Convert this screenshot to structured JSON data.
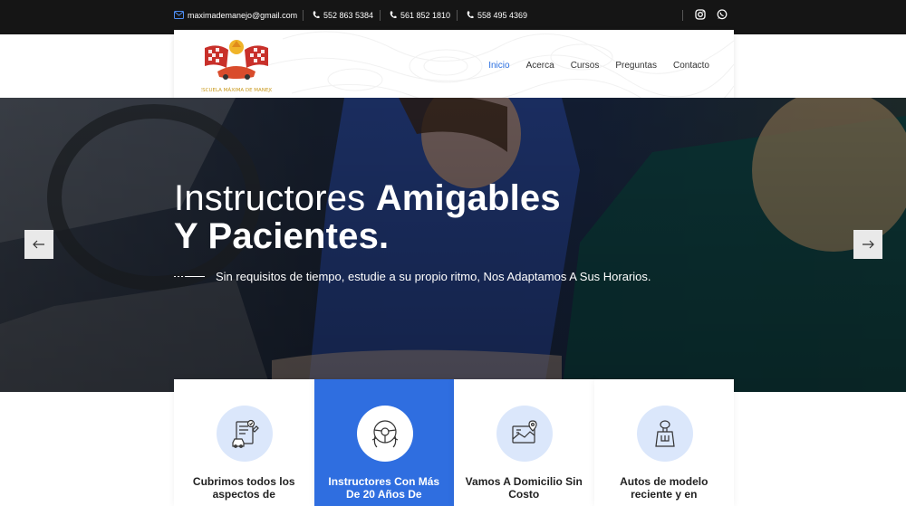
{
  "topbar": {
    "email": "maximademanejo@gmail.com",
    "phones": [
      "552 863 5384",
      "561 852 1810",
      "558 495 4369"
    ],
    "socials": [
      "instagram-icon",
      "whatsapp-icon"
    ]
  },
  "header": {
    "logo_text": "ESCUELA MÁXIMA DE MANEJO",
    "nav": [
      "Inicio",
      "Acerca",
      "Cursos",
      "Preguntas",
      "Contacto"
    ],
    "active_nav": "Inicio"
  },
  "hero": {
    "title_light_1": "Instructores",
    "title_bold_1": "Amigables",
    "title_bold_2": "Y Pacientes.",
    "subtitle": "Sin requisitos de tiempo, estudie a su propio ritmo, Nos Adaptamos A Sus Horarios."
  },
  "cards": [
    {
      "title": "Cubrimos todos los aspectos de",
      "icon": "checklist-car-icon"
    },
    {
      "title": "Instructores Con Más De 20 Años De",
      "icon": "steering-wheel-icon"
    },
    {
      "title": "Vamos A Domicilio Sin Costo",
      "icon": "map-location-icon"
    },
    {
      "title": "Autos de modelo reciente y en",
      "icon": "gear-shift-icon"
    }
  ],
  "colors": {
    "accent": "#2f6ee0",
    "nav_active": "#2a6fe0",
    "topbar": "#151515"
  }
}
